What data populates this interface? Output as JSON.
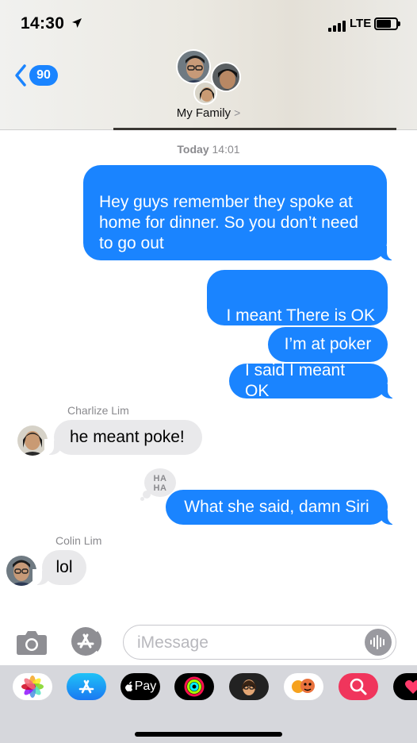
{
  "status_bar": {
    "time": "14:30",
    "network": "LTE"
  },
  "header": {
    "back_badge": "90",
    "group_name": "My Family",
    "chevron": ">"
  },
  "chat": {
    "timestamp_day": "Today",
    "timestamp_time": "14:01",
    "messages": [
      {
        "from": "me",
        "text_lines": [
          "Hey guys remember they spoke at",
          "home for dinner. So you don’t need",
          "to go out"
        ]
      },
      {
        "from": "me",
        "text": "I meant There is OK"
      },
      {
        "from": "me",
        "text": "I’m at poker"
      },
      {
        "from": "me",
        "text": "I said I meant OK"
      },
      {
        "from": "Charlize Lim",
        "sender": "Charlize Lim",
        "text": "he meant poke!"
      },
      {
        "from": "me",
        "text": "What she said, damn Siri",
        "tapback": "HA HA"
      },
      {
        "from": "Colin Lim",
        "sender": "Colin Lim",
        "text": "lol"
      }
    ],
    "tapback_line1": "HA",
    "tapback_line2": "HA"
  },
  "input": {
    "placeholder": "iMessage"
  },
  "app_tray": {
    "apps": [
      "photos-icon",
      "app-store-icon",
      "apple-pay-icon",
      "activity-icon",
      "memoji-icon",
      "animoji-icon",
      "search-images-icon",
      "digital-touch-icon"
    ],
    "apple_pay_label": "Pay"
  },
  "colors": {
    "bubble_outgoing": "#1a84ff",
    "bubble_incoming": "#e9e9eb",
    "tray": "#d6d7dc"
  }
}
